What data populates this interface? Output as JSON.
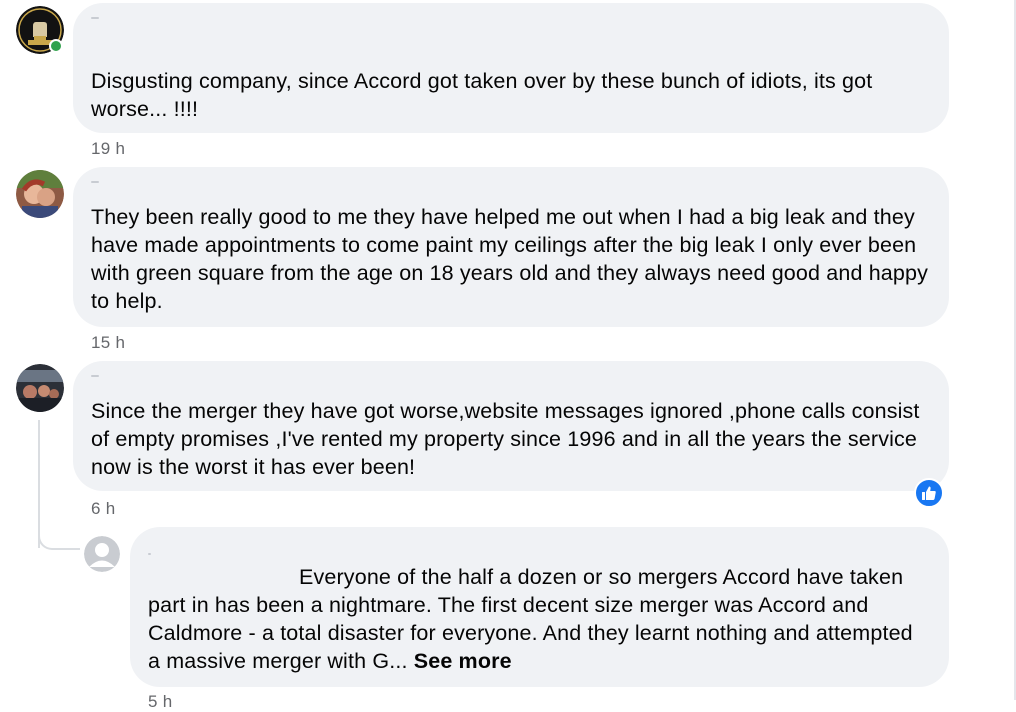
{
  "comments": [
    {
      "avatar": "northern-soul-fist-logo",
      "online": true,
      "text": "Disgusting company, since Accord got taken over by these bunch of idiots, its got worse... !!!!",
      "time": "19 h"
    },
    {
      "avatar": "user-photo",
      "text": "They been really good to me they have helped me out when I had a big leak and they have made appointments to come paint my ceilings after the big leak I only ever been with green square from the age on 18 years old and they always need good and happy to help.",
      "time": "15 h"
    },
    {
      "avatar": "user-photo",
      "text": "Since the merger they have got worse,website messages ignored ,phone calls consist of empty promises ,I've rented my property since 1996 and in all the years the service now is the worst it has ever been!",
      "time": "6 h",
      "reaction": "like-icon"
    },
    {
      "avatar": "default-person-icon",
      "is_reply": true,
      "text": "Everyone of the half a dozen or so mergers Accord have taken part in has been a nightmare. The first decent size merger was Accord and Caldmore - a total disaster for everyone. And they learnt nothing and attempted a massive merger with G...",
      "see_more": "See more",
      "time": "5 h"
    }
  ],
  "colors": {
    "bubble_bg": "#f0f2f5",
    "meta_text": "#65676b",
    "online_dot": "#31a24c",
    "like_blue": "#1877f2"
  }
}
